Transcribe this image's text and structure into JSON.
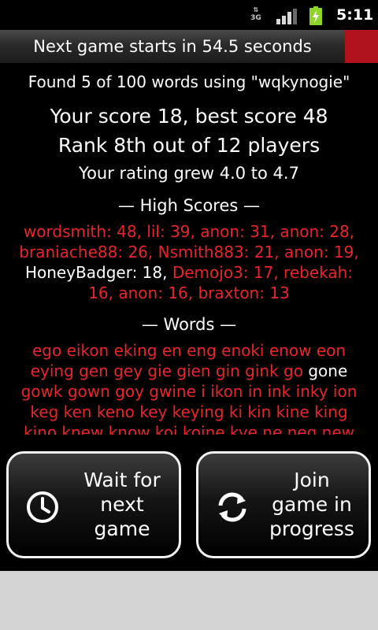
{
  "status_bar": {
    "network": "3G",
    "signal_icon": "signal-bars-icon",
    "battery_icon": "battery-charging-icon",
    "time": "5:11"
  },
  "banner": {
    "text": "Next game starts in 54.5 seconds",
    "accent_color": "#b0121e"
  },
  "summary": {
    "found": "Found 5 of 100 words using \"wqkynogie\"",
    "score": "Your score 18, best score 48",
    "rank": "Rank 8th out of 12 players",
    "rating": "Your rating grew 4.0 to 4.7"
  },
  "high_scores": {
    "title": "— High Scores —",
    "before": "wordsmith: 48, lil: 39, anon: 31, anon: 28, braniache88: 26, Nsmith883: 21, anon: 19,",
    "highlight": "HoneyBadger: 18,",
    "after": "Demojo3: 17, rebekah: 16, anon: 16, braxton: 13"
  },
  "words": {
    "title": "— Words —",
    "line1": "ego eikon eking en eng enoki enow eon",
    "line2_before": "eying gen gey gie gien gin gink go",
    "line2_highlight": "gone",
    "line3": "gowk gown goy gwine i ikon in ink inky ion",
    "line4": "keg ken keno key keying ki kin kine king",
    "line5": "kino knew know koi koine kye ne neg new"
  },
  "buttons": {
    "wait": {
      "label": "Wait for next game",
      "line1": "Wait for",
      "line2": "next",
      "line3": "game",
      "icon": "clock-icon"
    },
    "join": {
      "label": "Join game in progress",
      "line1": "Join",
      "line2": "game in",
      "line3": "progress",
      "icon": "refresh-icon"
    }
  },
  "colors": {
    "word_red": "#e8252b",
    "background": "#000000",
    "highlight": "#ffffff"
  }
}
